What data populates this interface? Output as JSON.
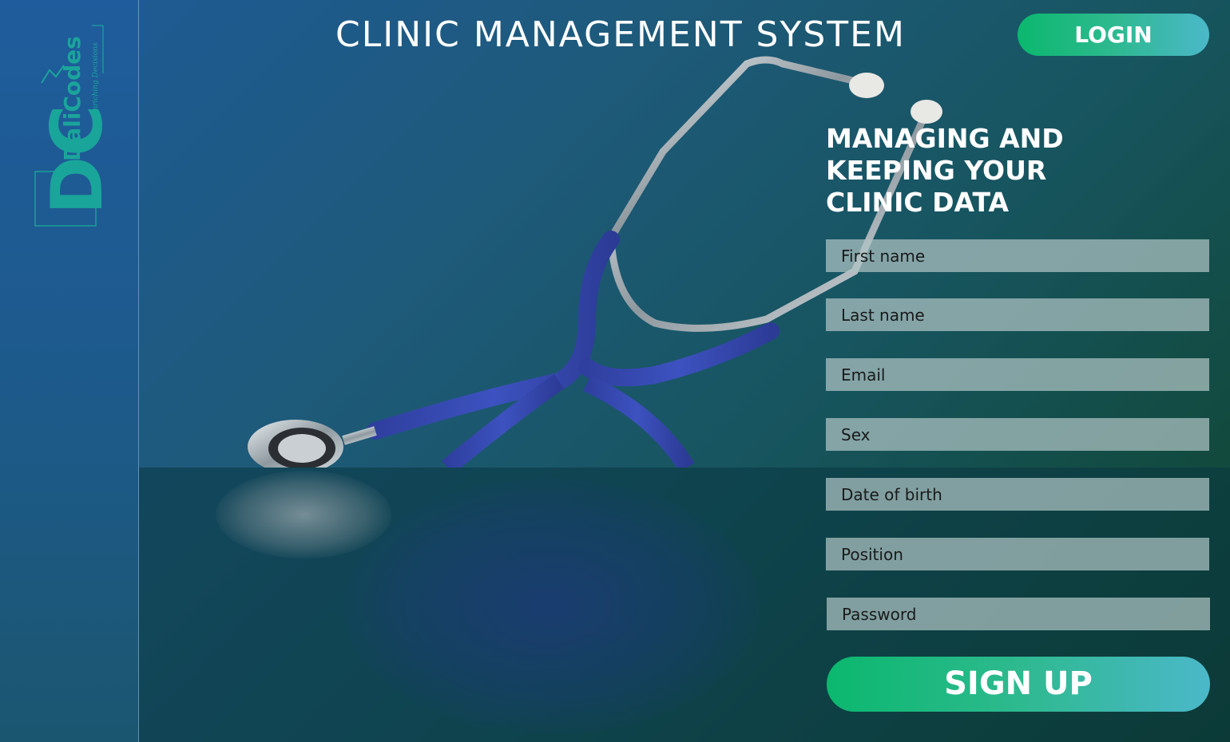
{
  "header": {
    "title": "CLINIC MANAGEMENT SYSTEM",
    "login_label": "LOGIN"
  },
  "logo": {
    "brand": "DaliCodes",
    "tagline": "Enriching Decisions",
    "monogram": "DC"
  },
  "hero": {
    "tagline_lines": [
      "MANAGING AND",
      "KEEPING YOUR",
      "CLINIC DATA"
    ],
    "image": "stethoscope-image"
  },
  "form": {
    "fields": [
      {
        "placeholder": "First name"
      },
      {
        "placeholder": "Last name"
      },
      {
        "placeholder": "Email"
      },
      {
        "placeholder": "Sex"
      },
      {
        "placeholder": "Date of birth"
      },
      {
        "placeholder": "Position"
      },
      {
        "placeholder": "Password"
      }
    ],
    "signup_label": "SIGN UP"
  },
  "colors": {
    "accent_green": "#0bb86e",
    "accent_teal": "#4bb8c9",
    "logo_teal": "#1aa59a",
    "tube_blue": "#3a4fb8"
  }
}
